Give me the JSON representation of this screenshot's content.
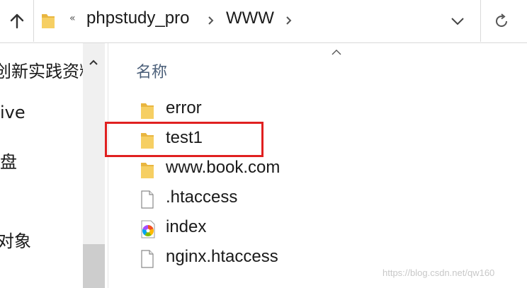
{
  "address_bar": {
    "overflow_label": "«",
    "breadcrumbs": [
      "phpstudy_pro",
      "WWW"
    ]
  },
  "nav_pane": {
    "items": [
      "创新实践资料",
      "ive",
      "盘",
      "对象"
    ]
  },
  "file_list": {
    "column_header": "名称",
    "files": [
      {
        "name": "error",
        "icon": "folder-icon"
      },
      {
        "name": "test1",
        "icon": "folder-icon"
      },
      {
        "name": "www.book.com",
        "icon": "folder-icon"
      },
      {
        "name": ".htaccess",
        "icon": "file-icon"
      },
      {
        "name": "index",
        "icon": "color-wheel-icon"
      },
      {
        "name": "nginx.htaccess",
        "icon": "file-icon"
      }
    ]
  },
  "watermark": "https://blog.csdn.net/qw160",
  "colors": {
    "folder": "#f4c958",
    "highlight": "#e02020",
    "header_text": "#4c607a"
  }
}
